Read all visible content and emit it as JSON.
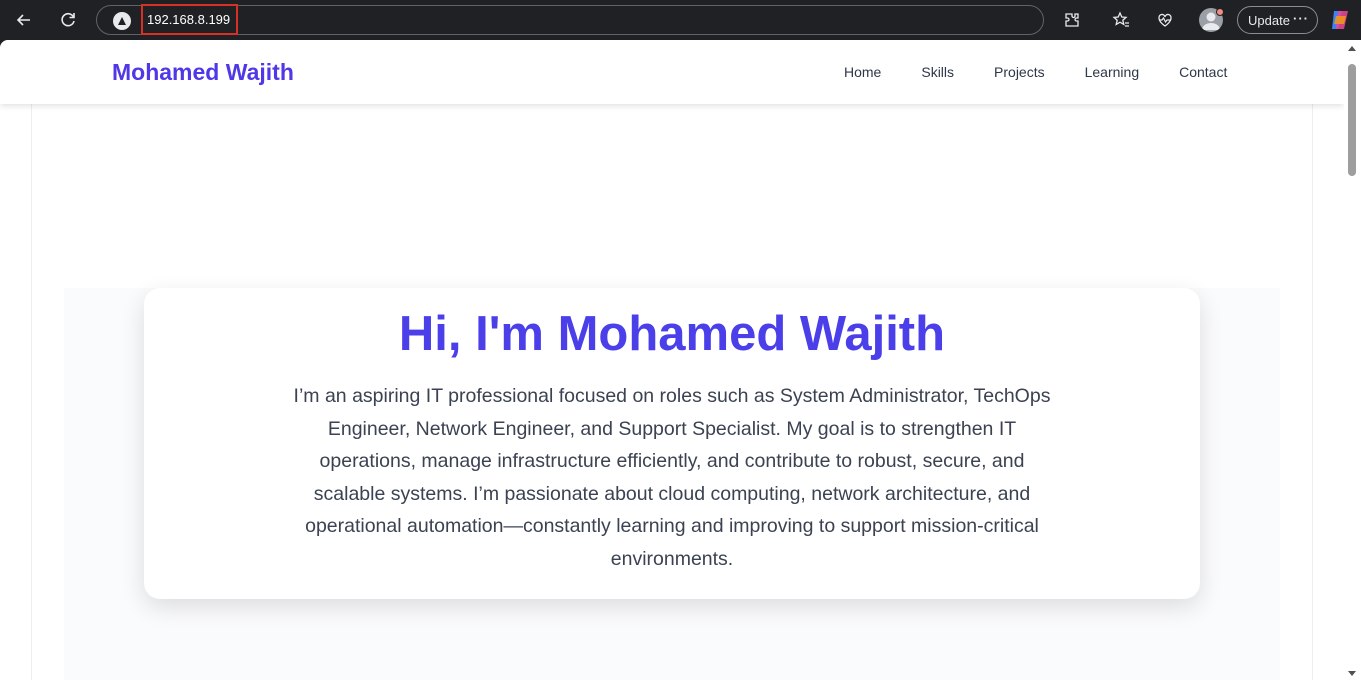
{
  "browser": {
    "url": "192.168.8.199",
    "update_label": "Update",
    "more_label": "···"
  },
  "site": {
    "brand": "Mohamed Wajith",
    "nav": [
      "Home",
      "Skills",
      "Projects",
      "Learning",
      "Contact"
    ]
  },
  "hero": {
    "title": "Hi, I'm Mohamed Wajith",
    "description": "I’m an aspiring IT professional focused on roles such as System Administrator, TechOps Engineer, Network Engineer, and Support Specialist. My goal is to strengthen IT operations, manage infrastructure efficiently, and contribute to robust, secure, and scalable systems. I’m passionate about cloud computing, network architecture, and operational automation—constantly learning and improving to support mission-critical environments."
  },
  "colors": {
    "brand": "#4f38e8",
    "hero_title": "#4a3fe8",
    "url_highlight": "#d93025"
  }
}
